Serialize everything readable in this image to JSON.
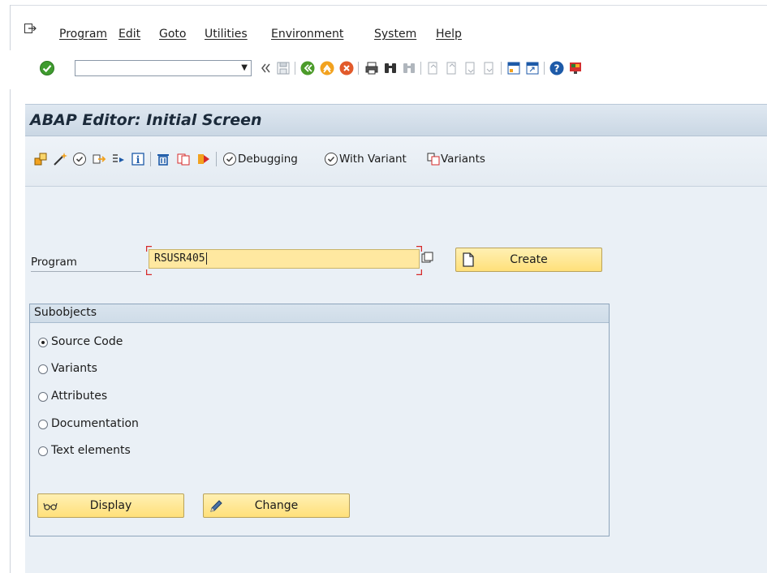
{
  "menu": {
    "items": [
      "Program",
      "Edit",
      "Goto",
      "Utilities",
      "Environment",
      "System",
      "Help"
    ]
  },
  "system_toolbar": {
    "command_field_value": "",
    "icons": [
      "enter-icon",
      "back-icon",
      "save-icon",
      "back-green-icon",
      "exit-icon",
      "cancel-icon",
      "print-icon",
      "find-icon",
      "find-next-icon",
      "first-page-icon",
      "previous-page-icon",
      "next-page-icon",
      "last-page-icon",
      "create-session-icon",
      "shortcut-icon",
      "help-icon",
      "layout-icon"
    ]
  },
  "screen": {
    "title": "ABAP Editor: Initial Screen"
  },
  "app_toolbar": {
    "debugging_label": "Debugging",
    "with_variant_label": "With Variant",
    "variants_label": "Variants"
  },
  "form": {
    "program_label": "Program",
    "program_value": "RSUSR405",
    "create_label": "Create",
    "subobjects_title": "Subobjects",
    "radios": [
      {
        "label": "Source Code",
        "selected": true
      },
      {
        "label": "Variants",
        "selected": false
      },
      {
        "label": "Attributes",
        "selected": false
      },
      {
        "label": "Documentation",
        "selected": false
      },
      {
        "label": "Text elements",
        "selected": false
      }
    ],
    "display_label": "Display",
    "change_label": "Change"
  },
  "colors": {
    "accent_yellow": "#ffe07a",
    "input_required": "#ffe8a0",
    "title_bar": "#cad7e4",
    "background": "#eaf0f6",
    "required_marker": "#d62a2a"
  }
}
